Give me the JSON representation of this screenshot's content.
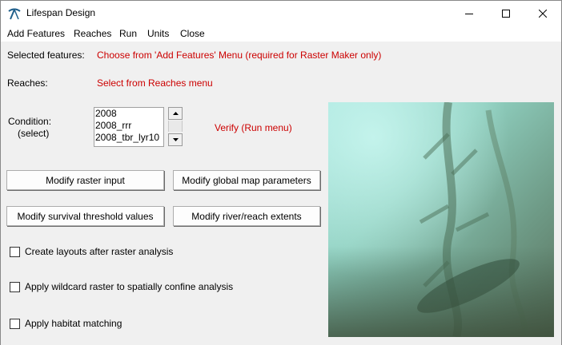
{
  "window": {
    "title": "Lifespan Design",
    "icon": "pickaxe-app-icon"
  },
  "menu": {
    "items": [
      {
        "label": "Add Features"
      },
      {
        "label": "Reaches"
      },
      {
        "label": "Run"
      },
      {
        "label": "Units"
      },
      {
        "label": "Close"
      }
    ]
  },
  "selected_features": {
    "label": "Selected features:",
    "hint": "Choose from 'Add Features' Menu (required for Raster Maker only)"
  },
  "reaches": {
    "label": "Reaches:",
    "hint": "Select from Reaches menu"
  },
  "condition": {
    "label_line1": "Condition:",
    "label_line2": "(select)",
    "options": [
      "2008",
      "2008_rrr",
      "2008_tbr_lyr10"
    ],
    "verify_hint": "Verify (Run menu)"
  },
  "buttons": {
    "modify_raster_input": "Modify raster input",
    "modify_global_map_parameters": "Modify global map parameters",
    "modify_survival_threshold_values": "Modify survival threshold values",
    "modify_river_reach_extents": "Modify river/reach extents"
  },
  "checkboxes": [
    {
      "label": "Create layouts after raster analysis",
      "checked": false
    },
    {
      "label": "Apply wildcard raster to spatially confine analysis",
      "checked": false
    },
    {
      "label": "Apply habitat matching",
      "checked": false
    }
  ],
  "colors": {
    "hint_red": "#cc0000",
    "background": "#f0f0f0"
  }
}
